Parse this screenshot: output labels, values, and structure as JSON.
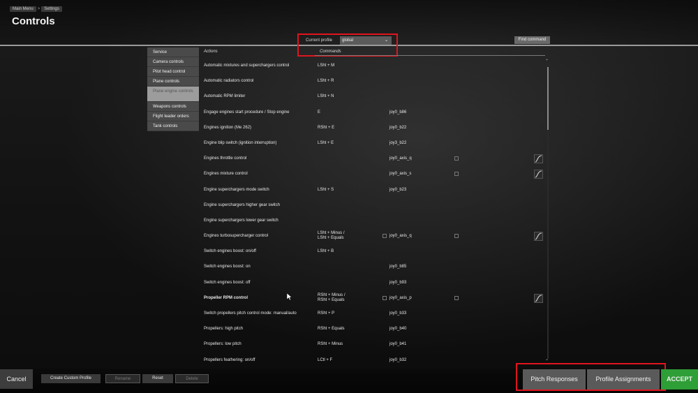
{
  "header": {
    "breadcrumb": [
      "Main Menu",
      "Settings"
    ],
    "title": "Controls"
  },
  "profile": {
    "label": "Current profile",
    "value": "global",
    "find_command": "Find command"
  },
  "columns": {
    "actions": "Actions",
    "commands": "Commands"
  },
  "categories": [
    {
      "label": "Service"
    },
    {
      "label": "Camera controls"
    },
    {
      "label": "Pilot head control"
    },
    {
      "label": "Plane controls"
    },
    {
      "label": "Plane engine controls"
    },
    {
      "label": "Weapons controls"
    },
    {
      "label": "Flight leader orders"
    },
    {
      "label": "Tank controls"
    }
  ],
  "active_category": "Plane engine controls",
  "rows": [
    {
      "action": "Automatic mixtures and superchargers control",
      "cmd1": "LSht + M",
      "cmd2": ""
    },
    {
      "action": "Automatic radiators control",
      "cmd1": "LSht + R",
      "cmd2": ""
    },
    {
      "action": "Automatic RPM limiter",
      "cmd1": "LSht + N",
      "cmd2": ""
    },
    {
      "action": "Engage engines start procedure / Stop engine",
      "cmd1": "E",
      "cmd2": "joy0_b86"
    },
    {
      "action": "Engines ignition (Me 262)",
      "cmd1": "RSht + E",
      "cmd2": "joy0_b22"
    },
    {
      "action": "Engine blip switch (ignition interruption)",
      "cmd1": "LSht + E",
      "cmd2": "joy3_b22"
    },
    {
      "action": "Engines throttle control",
      "cmd1": "",
      "cmd2": "joy0_axis_q"
    },
    {
      "action": "Engines mixture control",
      "cmd1": "",
      "cmd2": "joy0_axis_s"
    },
    {
      "action": "Engine superchargers mode switch",
      "cmd1": "LSht + S",
      "cmd2": "joy0_b23"
    },
    {
      "action": "Engine superchargers higher gear switch",
      "cmd1": "",
      "cmd2": ""
    },
    {
      "action": "Engine superchargers lower gear switch",
      "cmd1": "",
      "cmd2": ""
    },
    {
      "action": "Engines turbosupercharger control",
      "cmd1": "LSht + Minus / LSht + Equals",
      "cmd2": "joy0_axis_q"
    },
    {
      "action": "Switch engines boost: on/off",
      "cmd1": "LSht + B",
      "cmd2": ""
    },
    {
      "action": "Switch engines boost: on",
      "cmd1": "",
      "cmd2": "joy0_b85"
    },
    {
      "action": "Switch engines boost: off",
      "cmd1": "",
      "cmd2": "joy0_b93"
    },
    {
      "action": "Propeller RPM control",
      "cmd1": "RSht + Minus / RSht + Equals",
      "cmd2": "joy0_axis_p"
    },
    {
      "action": "Switch propellers pitch control mode: manual/auto",
      "cmd1": "RSht + P",
      "cmd2": "joy0_b33"
    },
    {
      "action": "Propellers: high pitch",
      "cmd1": "RSht + Equals",
      "cmd2": "joy0_b40"
    },
    {
      "action": "Propellers: low pitch",
      "cmd1": "RSht + Minus",
      "cmd2": "joy0_b41"
    },
    {
      "action": "Propellers feathering: on/off",
      "cmd1": "LCtl + F",
      "cmd2": "joy0_b32"
    }
  ],
  "footer": {
    "cancel": "Cancel",
    "create_profile": "Create Custom Profile",
    "rename": "Rename",
    "reset": "Reset",
    "delete": "Delete",
    "pitch_responses": "Pitch Responses",
    "profile_assignments": "Profile Assignments",
    "accept": "ACCEPT"
  },
  "colors": {
    "highlight_box": "#e0141e",
    "accept": "#2e9e36"
  }
}
